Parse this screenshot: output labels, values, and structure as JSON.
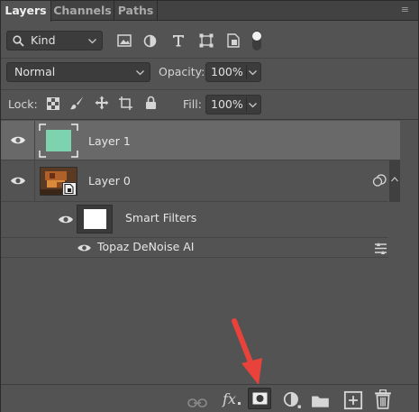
{
  "tabs": [
    {
      "label": "Layers",
      "active": true
    },
    {
      "label": "Channels",
      "active": false
    },
    {
      "label": "Paths",
      "active": false
    }
  ],
  "tab_menu": "≡",
  "filter": {
    "kind_label": "Kind",
    "filter_icons": [
      "pixel-filter-icon",
      "adjustment-filter-icon",
      "type-filter-icon",
      "shape-filter-icon",
      "smart-object-filter-icon",
      "filter-toggle-icon"
    ]
  },
  "blend": {
    "mode": "Normal",
    "opacity_label": "Opacity:",
    "opacity_value": "100%"
  },
  "lock": {
    "label": "Lock:",
    "icons": [
      "lock-transparent-pixels-icon",
      "lock-image-pixels-icon",
      "lock-position-icon",
      "lock-artboard-icon",
      "lock-all-icon"
    ],
    "fill_label": "Fill:",
    "fill_value": "100%"
  },
  "layers": [
    {
      "name": "Layer 1",
      "selected": true,
      "thumb_color": "#7dd3ad"
    },
    {
      "name": "Layer 0",
      "selected": false
    },
    {
      "name": "Smart Filters",
      "selected": false
    },
    {
      "name": "Topaz DeNoise AI",
      "selected": false
    }
  ],
  "bottom_icons": [
    "link-layers-icon",
    "fx-icon",
    "add-mask-icon",
    "adjustment-layer-icon",
    "group-folder-icon",
    "new-layer-icon",
    "trash-icon"
  ],
  "fx_label": "fx",
  "colors": {
    "panel_bg": "#535353",
    "selected_row": "#696969",
    "arrow": "#e8423a",
    "mask_thumb": "#7dd3ad"
  }
}
